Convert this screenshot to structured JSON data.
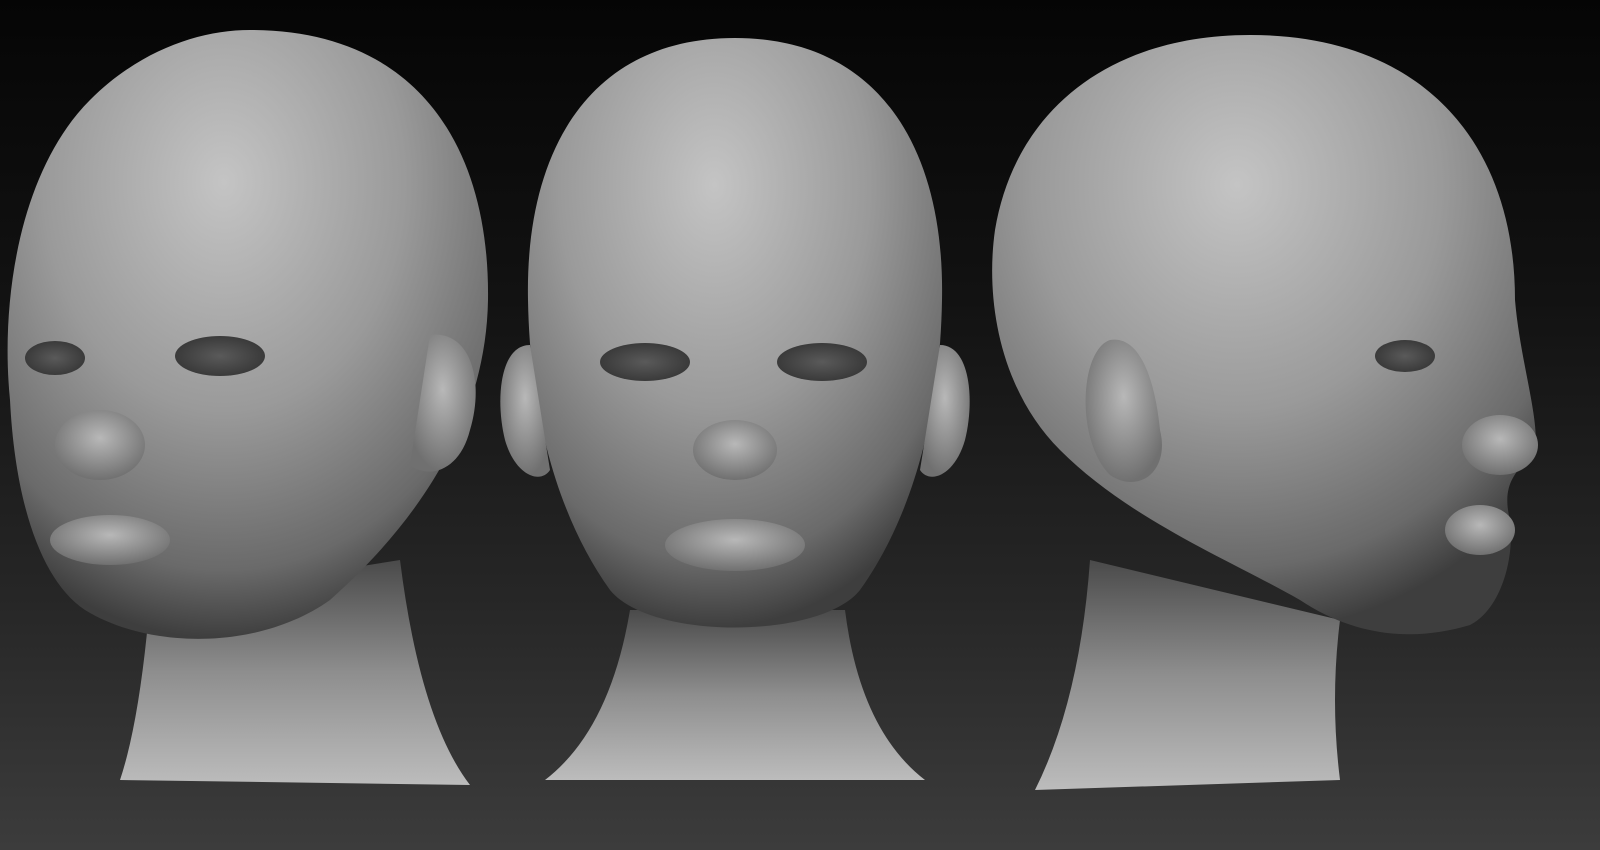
{
  "scene": {
    "subject": "sculpted head",
    "views": [
      {
        "id": "three-quarter-left"
      },
      {
        "id": "front"
      },
      {
        "id": "profile-right"
      }
    ],
    "colors": {
      "background_top": "#050505",
      "background_bottom": "#3c3c3c",
      "clay_light": "#bdbdbd",
      "clay_mid": "#8a8a8a",
      "clay_dark": "#3a3a3a"
    }
  }
}
